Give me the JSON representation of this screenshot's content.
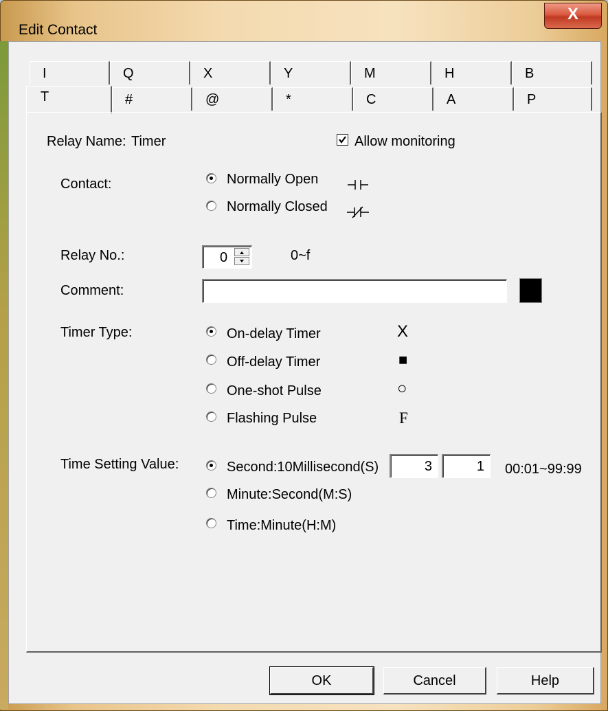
{
  "window": {
    "title": "Edit Contact",
    "close_label": "X"
  },
  "tabs_row1": [
    "I",
    "Q",
    "X",
    "Y",
    "M",
    "H",
    "B"
  ],
  "tabs_row2": [
    "T",
    "#",
    "@",
    "*",
    "C",
    "A",
    "P"
  ],
  "relay": {
    "label": "Relay Name:",
    "name": "Timer"
  },
  "allow_monitoring": {
    "label": "Allow monitoring",
    "checked": true
  },
  "contact": {
    "label": "Contact:",
    "options": [
      {
        "label": "Normally Open",
        "selected": true,
        "symbol": "normally-open-symbol"
      },
      {
        "label": "Normally Closed",
        "selected": false,
        "symbol": "normally-closed-symbol"
      }
    ]
  },
  "relay_no": {
    "label": "Relay No.:",
    "value": "0",
    "range": "0~f"
  },
  "comment": {
    "label": "Comment:",
    "value": "",
    "color": "#000000"
  },
  "timer_type": {
    "label": "Timer Type:",
    "options": [
      {
        "label": "On-delay Timer",
        "selected": true,
        "symbol": "X"
      },
      {
        "label": "Off-delay Timer",
        "selected": false,
        "symbol": "■"
      },
      {
        "label": "One-shot Pulse",
        "selected": false,
        "symbol": "○"
      },
      {
        "label": "Flashing Pulse",
        "selected": false,
        "symbol": "F"
      }
    ]
  },
  "time_setting": {
    "label": "Time Setting Value:",
    "options": [
      {
        "label": "Second:10Millisecond(S)",
        "selected": true
      },
      {
        "label": "Minute:Second(M:S)",
        "selected": false
      },
      {
        "label": "Time:Minute(H:M)",
        "selected": false
      }
    ],
    "value1": "3",
    "value2": "1",
    "range": "00:01~99:99"
  },
  "buttons": {
    "ok": "OK",
    "cancel": "Cancel",
    "help": "Help"
  }
}
